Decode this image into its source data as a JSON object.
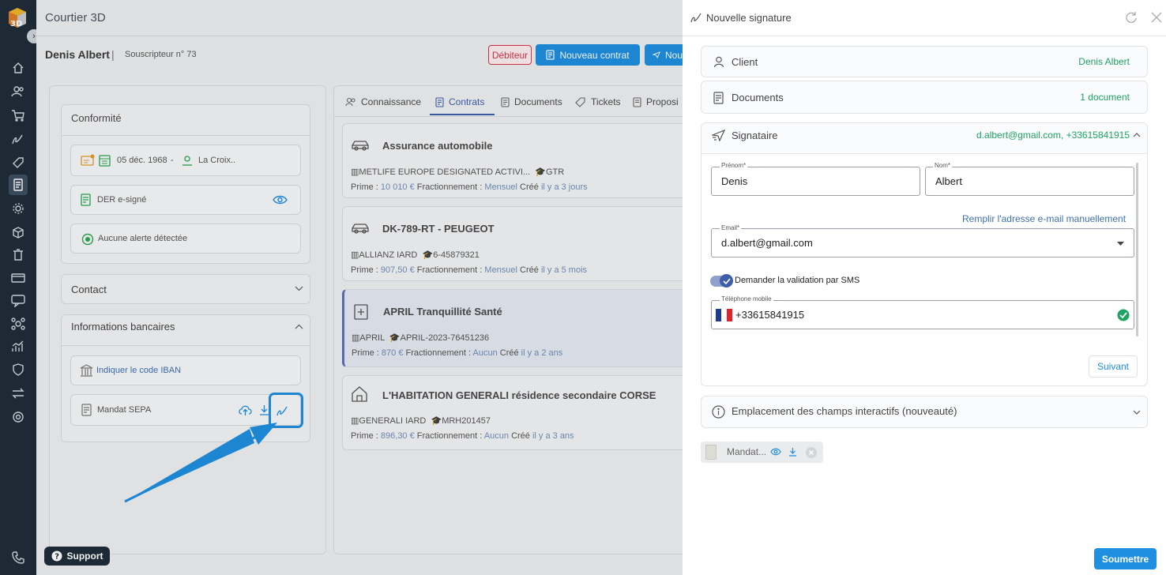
{
  "app": {
    "title": "Courtier 3D"
  },
  "client": {
    "name": "Denis Albert",
    "separator": "|",
    "subscriber": "Souscripteur n° 73"
  },
  "header": {
    "debiteur": "Débiteur",
    "nouveau_contrat": "Nouveau contrat",
    "nouveau_partial": "Nou"
  },
  "left": {
    "conformite": {
      "title": "Conformité",
      "birthdate": "05 déc. 1968",
      "dash": "-",
      "place": "La Croix..",
      "der": "DER e-signé",
      "alert": "Aucune alerte détectée"
    },
    "contact": {
      "title": "Contact"
    },
    "bank": {
      "title": "Informations bancaires",
      "iban": "Indiquer le code IBAN",
      "mandat": "Mandat SEPA"
    }
  },
  "tabs": [
    "Connaissance",
    "Contrats",
    "Documents",
    "Tickets",
    "Proposi"
  ],
  "contracts": [
    {
      "title": "Assurance automobile",
      "insurer": "METLIFE EUROPE DESIGNATED ACTIVI...",
      "ref": "GTR",
      "prime_label": "Prime :",
      "prime": "10 010 €",
      "frac_label": "Fractionnement :",
      "frac": "Mensuel",
      "created_label": "Créé",
      "created": "il y a 3 jours"
    },
    {
      "title": "DK-789-RT - PEUGEOT",
      "insurer": "ALLIANZ IARD",
      "ref": "6-45879321",
      "prime_label": "Prime :",
      "prime": "907,50 €",
      "frac_label": "Fractionnement :",
      "frac": "Mensuel",
      "created_label": "Créé",
      "created": "il y a 5 mois"
    },
    {
      "title": "APRIL Tranquillité Santé",
      "insurer": "APRIL",
      "ref": "APRIL-2023-76451236",
      "prime_label": "Prime :",
      "prime": "870 €",
      "frac_label": "Fractionnement :",
      "frac": "Aucun",
      "created_label": "Créé",
      "created": "il y a 2 ans"
    },
    {
      "title": "L'HABITATION GENERALI résidence secondaire CORSE",
      "insurer": "GENERALI IARD",
      "ref": "MRH201457",
      "prime_label": "Prime :",
      "prime": "896,30 €",
      "frac_label": "Fractionnement :",
      "frac": "Aucun",
      "created_label": "Créé",
      "created": "il y a 3 ans"
    }
  ],
  "support": "Support",
  "panel": {
    "title": "Nouvelle signature",
    "client": {
      "label": "Client",
      "value": "Denis Albert"
    },
    "documents": {
      "label": "Documents",
      "value": "1 document"
    },
    "signataire": {
      "label": "Signataire",
      "value": "d.albert@gmail.com, +33615841915"
    },
    "prenom": {
      "label": "Prénom*",
      "value": "Denis"
    },
    "nom": {
      "label": "Nom*",
      "value": "Albert"
    },
    "manual_email": "Remplir l'adresse e-mail manuellement",
    "email": {
      "label": "Email*",
      "value": "d.albert@gmail.com"
    },
    "sms_toggle": {
      "label": "Demander la validation par SMS",
      "checked": true
    },
    "phone": {
      "label": "Téléphone mobile",
      "value": "+33615841915"
    },
    "suivant": "Suivant",
    "emplacement": "Emplacement des champs interactifs (nouveauté)",
    "file": "Mandat...",
    "submit": "Soumettre"
  },
  "colors": {
    "sidebar": "#1f2d3a",
    "primary": "#1e8fe1",
    "green": "#1ea363",
    "link": "#6f8fb8",
    "debiteur": "#d9354a"
  }
}
